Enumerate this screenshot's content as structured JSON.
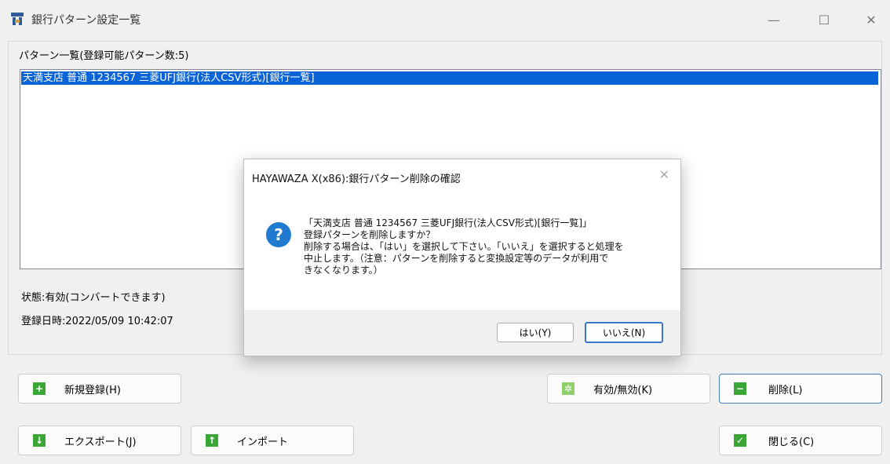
{
  "window": {
    "title": "銀行パターン設定一覧",
    "minimize": "—",
    "maximize": "☐",
    "close": "✕"
  },
  "group": {
    "label": "パターン一覧(登録可能パターン数:5)"
  },
  "list": {
    "items": [
      "天満支店 普通 1234567 三菱UFJ銀行(法人CSV形式)[銀行一覧]"
    ],
    "selected_index": 0
  },
  "details": {
    "status": "状態:有効(コンバートできます)",
    "registered": "登録日時:2022/05/09 10:42:07"
  },
  "buttons": {
    "new": "新規登録(H)",
    "toggle": "有効/無効(K)",
    "delete": "削除(L)",
    "export": "エクスポート(J)",
    "import": "インポート",
    "close": "閉じる(C)"
  },
  "dialog": {
    "title": "HAYAWAZA X(x86):銀行パターン削除の確認",
    "close": "✕",
    "icon": "question-icon",
    "message_lines": [
      "「天満支店 普通 1234567 三菱UFJ銀行(法人CSV形式)[銀行一覧]」",
      "登録パターンを削除しますか？",
      "削除する場合は、「はい」を選択して下さい。「いいえ」を選択すると処理を",
      "中止します。（注意：パターンを削除すると変換設定等のデータが利用で",
      "きなくなります。）"
    ],
    "yes": "はい(Y)",
    "no": "いいえ(N)"
  },
  "colors": {
    "selection": "#0a64d6",
    "accent_icon": "#3aa635",
    "question_icon": "#1f7ad0"
  }
}
